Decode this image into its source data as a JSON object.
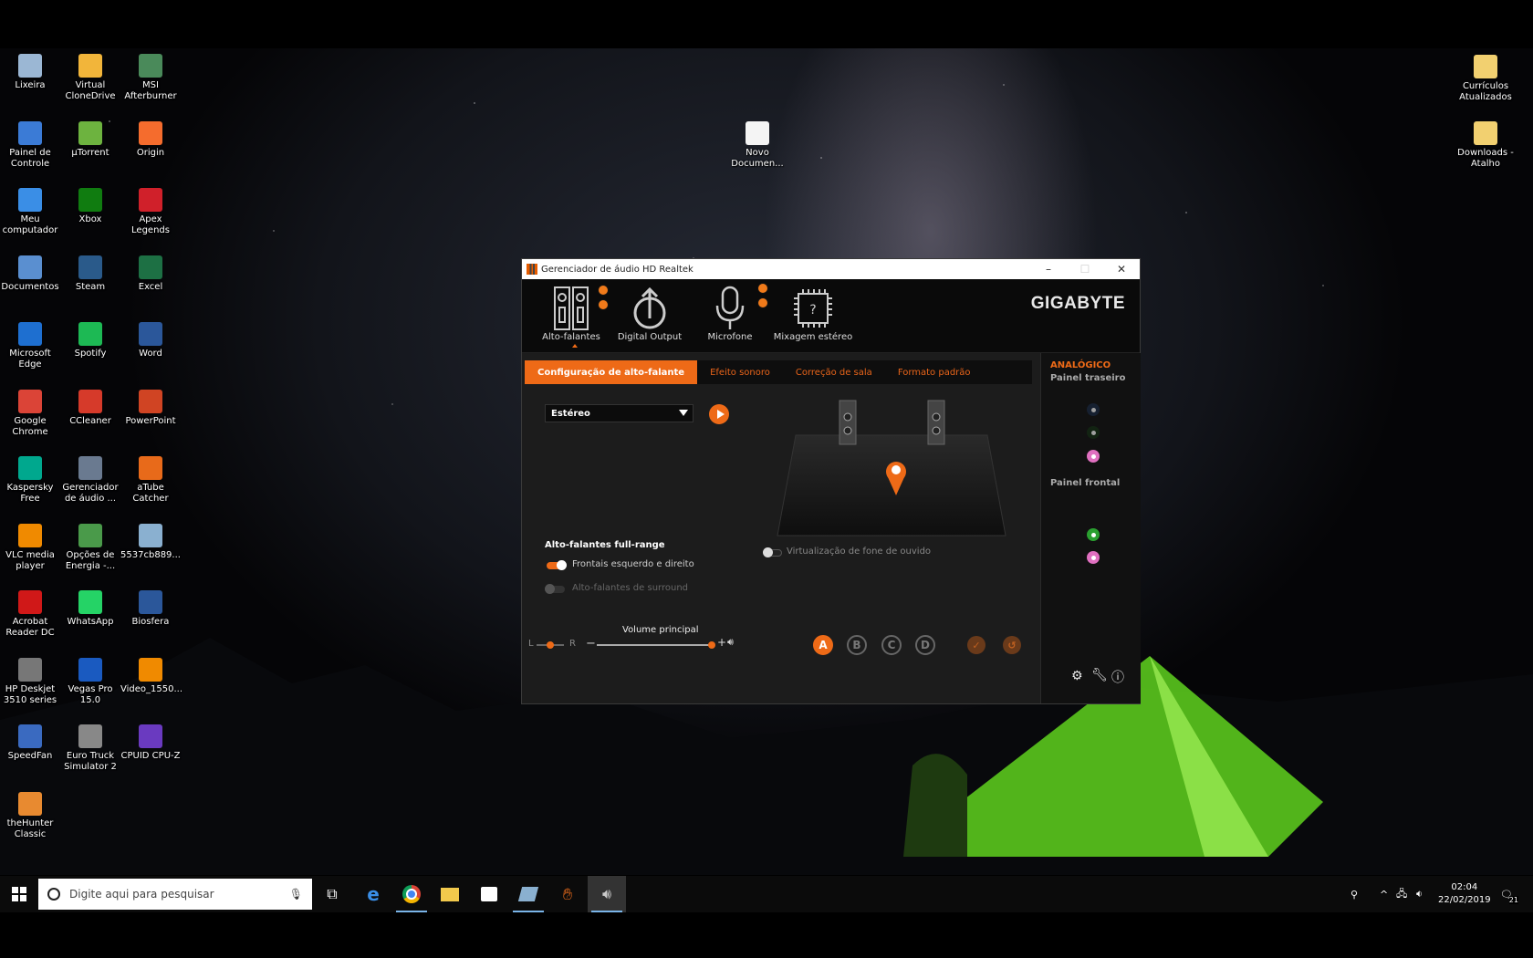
{
  "desktop": {
    "icons_left": [
      {
        "label": "Lixeira",
        "icon": "recycle-bin-icon",
        "color": "#9bb7d4"
      },
      {
        "label": "Virtual CloneDrive",
        "icon": "clonedrive-icon",
        "color": "#f2b53a"
      },
      {
        "label": "MSI Afterburner",
        "icon": "afterburner-icon",
        "color": "#4a8a5a"
      },
      {
        "label": "Painel de Controle",
        "icon": "control-panel-icon",
        "color": "#3b7bd6"
      },
      {
        "label": "µTorrent",
        "icon": "utorrent-icon",
        "color": "#6db33f"
      },
      {
        "label": "Origin",
        "icon": "origin-icon",
        "color": "#f56c2d"
      },
      {
        "label": "Meu computador",
        "icon": "computer-icon",
        "color": "#3a8ee6"
      },
      {
        "label": "Xbox",
        "icon": "xbox-icon",
        "color": "#107c10"
      },
      {
        "label": "Apex Legends",
        "icon": "apex-icon",
        "color": "#d0202a"
      },
      {
        "label": "Documentos",
        "icon": "documents-icon",
        "color": "#5a8fd0"
      },
      {
        "label": "Steam",
        "icon": "steam-icon",
        "color": "#2a5a8a"
      },
      {
        "label": "Excel",
        "icon": "excel-icon",
        "color": "#1d7044"
      },
      {
        "label": "Microsoft Edge",
        "icon": "edge-icon",
        "color": "#1e6fd0"
      },
      {
        "label": "Spotify",
        "icon": "spotify-icon",
        "color": "#1db954"
      },
      {
        "label": "Word",
        "icon": "word-icon",
        "color": "#2b579a"
      },
      {
        "label": "Google Chrome",
        "icon": "chrome-icon",
        "color": "#db4437"
      },
      {
        "label": "CCleaner",
        "icon": "ccleaner-icon",
        "color": "#d63a2a"
      },
      {
        "label": "PowerPoint",
        "icon": "powerpoint-icon",
        "color": "#d04423"
      },
      {
        "label": "Kaspersky Free",
        "icon": "kaspersky-icon",
        "color": "#00a88e"
      },
      {
        "label": "Gerenciador de áudio ...",
        "icon": "audio-manager-icon",
        "color": "#6a7a90"
      },
      {
        "label": "aTube Catcher",
        "icon": "atube-icon",
        "color": "#e86a1a"
      },
      {
        "label": "VLC media player",
        "icon": "vlc-icon",
        "color": "#f08a00"
      },
      {
        "label": "Opções de Energia -...",
        "icon": "power-options-icon",
        "color": "#4a9a4a"
      },
      {
        "label": "5537cb889...",
        "icon": "image-file-icon",
        "color": "#8ab0d0"
      },
      {
        "label": "Acrobat Reader DC",
        "icon": "acrobat-icon",
        "color": "#d01818"
      },
      {
        "label": "WhatsApp",
        "icon": "whatsapp-icon",
        "color": "#25d366"
      },
      {
        "label": "Biosfera",
        "icon": "word-doc-icon",
        "color": "#2b579a"
      },
      {
        "label": "HP Deskjet 3510 series",
        "icon": "printer-icon",
        "color": "#777777"
      },
      {
        "label": "Vegas Pro 15.0",
        "icon": "vegas-icon",
        "color": "#1a5ac0"
      },
      {
        "label": "Video_1550...",
        "icon": "vlc-file-icon",
        "color": "#f08a00"
      },
      {
        "label": "SpeedFan",
        "icon": "speedfan-icon",
        "color": "#3a6ac0"
      },
      {
        "label": "Euro Truck Simulator 2",
        "icon": "truck-icon",
        "color": "#888888"
      },
      {
        "label": "CPUID CPU-Z",
        "icon": "cpuz-icon",
        "color": "#6a3ac0"
      },
      {
        "label": "theHunter Classic",
        "icon": "hunter-icon",
        "color": "#e88a30"
      }
    ],
    "icon_middle": {
      "label": "Novo Documen...",
      "icon": "text-document-icon"
    },
    "icons_right": [
      {
        "label": "Currículos Atualizados",
        "icon": "folder-icon"
      },
      {
        "label": "Downloads - Atalho",
        "icon": "folder-shortcut-icon"
      }
    ]
  },
  "window": {
    "title": "Gerenciador de áudio HD Realtek",
    "brand": "GIGABYTE",
    "top_tabs": [
      {
        "label": "Alto-falantes",
        "icon": "speakers-icon"
      },
      {
        "label": "Digital Output",
        "icon": "digital-output-icon"
      },
      {
        "label": "Microfone",
        "icon": "microphone-icon"
      },
      {
        "label": "Mixagem estéreo",
        "icon": "stereo-mix-icon"
      }
    ],
    "tabs": [
      "Configuração de alto-falante",
      "Efeito sonoro",
      "Correção de sala",
      "Formato padrão"
    ],
    "speaker_config": "Estéreo",
    "fullrange_title": "Alto-falantes full-range",
    "fullrange_front": "Frontais esquerdo e direito",
    "fullrange_surround": "Alto-falantes de surround",
    "headphone_virtualization": "Virtualização de fone de ouvido",
    "volume_label": "Volume principal",
    "balance_left": "L",
    "balance_right": "R",
    "profiles": [
      "A",
      "B",
      "C",
      "D"
    ],
    "side": {
      "title": "ANALÓGICO",
      "rear_label": "Painel traseiro",
      "front_label": "Painel frontal"
    },
    "accent": "#ee6a17"
  },
  "taskbar": {
    "search_placeholder": "Digite aqui para pesquisar",
    "time": "02:04",
    "date": "22/02/2019",
    "notif_count": "21"
  }
}
